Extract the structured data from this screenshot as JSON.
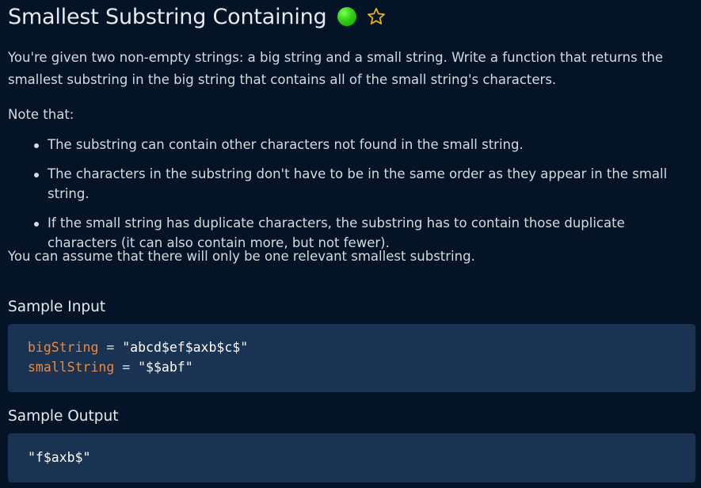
{
  "problem": {
    "title": "Smallest Substring Containing",
    "difficulty_color": "#2fcf16",
    "favorite_icon": "star-outline-icon",
    "description": "You're given two non-empty strings: a big string and a small string. Write a function that returns the smallest substring in the big string that contains all of the small string's characters.",
    "note_intro": "Note that:",
    "notes": [
      "The substring can contain other characters not found in the small string.",
      "The characters in the substring don't have to be in the same order as they appear in the small string.",
      "If the small string has duplicate characters, the substring has to contain those duplicate characters (it can also contain more, but not fewer)."
    ],
    "assumption": "You can assume that there will only be one relevant smallest substring."
  },
  "sample_input": {
    "heading": "Sample Input",
    "lines": [
      {
        "var": "bigString",
        "op": " = ",
        "value": "\"abcd$ef$axb$c$\""
      },
      {
        "var": "smallString",
        "op": " = ",
        "value": "\"$$abf\""
      }
    ]
  },
  "sample_output": {
    "heading": "Sample Output",
    "value": "\"f$axb$\""
  },
  "colors": {
    "background": "#041426",
    "code_background": "#1a3352",
    "variable": "#e58a45",
    "star": "#f2b600"
  }
}
